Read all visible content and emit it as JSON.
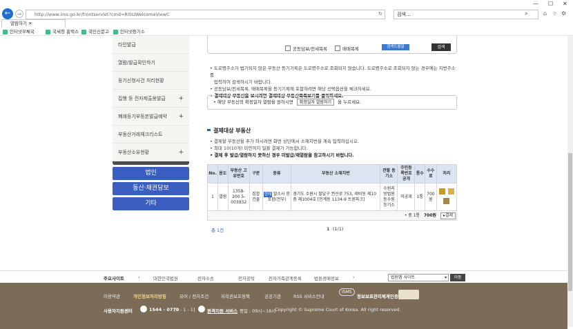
{
  "browser": {
    "url": "http://www.iros.go.kr/frontservlet?cmd=RISUWelcomeViewC",
    "search_placeholder": "검색...",
    "tab_title": "열람하기",
    "favorites": [
      "인터넷우체국",
      "국세청 홈택스",
      "국민신문고",
      "인터넷등기소"
    ]
  },
  "sidebar": {
    "items": [
      {
        "label": "타인발급",
        "plus": ""
      },
      {
        "label": "열람/발급확인하기",
        "plus": ""
      },
      {
        "label": "등기신청사건 처리현황",
        "plus": ""
      },
      {
        "label": "집행 등 전자제출용발급",
        "plus": "+"
      },
      {
        "label": "폐쇄등기부등본발급예약",
        "plus": "+"
      },
      {
        "label": "부동산거래체크리스트",
        "plus": ""
      },
      {
        "label": "부동산소유현황",
        "plus": "+"
      }
    ],
    "buttons": [
      "법인",
      "동산·채권담보",
      "기타"
    ]
  },
  "options": {
    "check1": "공동담보/전세목록",
    "check2": "매매목록",
    "help": "검색도움말",
    "search": "검색"
  },
  "notes": {
    "line1": "도로명주소가 법기되지 않은 부동산 등기기록은 도로명주소로 조회되지 않습니다. 도로명주소로 조회되지 않는 경우에는 지번주소를",
    "line1b": "입력하여 검색하시기 바랍니다.",
    "line2": "공동담보/전세목록, 매매목록을 등기기록에 포함하려면 해당 선택옵션을 체크하세요.",
    "line3": "결제대상 부동산을 보시려면 결제대상 부동산목록보기를 클릭하세요.",
    "box_text": "해당 부동산의 확정일자 열람을 원하시면",
    "box_button": "확정일자 열람하기",
    "box_suffix": "을 누르세요."
  },
  "section": {
    "title": "결제대상 부동산",
    "n1": "결제할 부동산을 추가 하시려면 화면 상단에서 소재지번을 계속 입력하십시오.",
    "n2": "최대 10(10개) 미만까지 일괄 결제가 가능합니다.",
    "n3": "결제 후 발급/열람하지 못하신 경우 미발급/재열람을 참고하시기 바랍니다."
  },
  "table": {
    "headers": [
      "No.",
      "용도",
      "부동산 고유번호",
      "구분",
      "종류",
      "부동산 소재지번",
      "관할 등기소",
      "주민등록번호 공개",
      "통수",
      "수수료",
      "처리"
    ],
    "row": {
      "no": "1",
      "use": "열람",
      "id": "1358-200 5-003932",
      "kind": "집합 건물",
      "type_tag": "현재",
      "type": "말소사 항포함(전부)",
      "addr": "경기도 수원시 팔달구 권선로 753, 제비동 제10층 제1004호 [인계동 1134-9 트윈파크]",
      "office": "수원지방법원 동수원 등기소",
      "rrn": "미공개",
      "count": "1통",
      "fee": "700원"
    },
    "total_label": "• 총 1통",
    "total_fee": "700원",
    "pay_button": "결제"
  },
  "pager": {
    "total": "총 1건",
    "page": "1",
    "of": "(1/1)"
  },
  "footer_links": {
    "label": "주요사이트",
    "items": [
      "대한민국법원",
      "전자소송",
      "전자공탁",
      "전자가족관계등록",
      "법원경매정보"
    ],
    "select": "법원맵 사이트",
    "go": "이동"
  },
  "footer": {
    "links": [
      "이용약관",
      "개인정보처리방침",
      "뷰어 / 전자조건",
      "저작권보호정책",
      "공공기관",
      "RSS 서비스안내"
    ],
    "badge": "ISMS",
    "badge_text": "정보보호관리체계인증",
    "center": "사용자지원센터",
    "phone": "1544 - 0770",
    "ext": "[0 - 1 - 1]",
    "remote": "원격지원 서비스",
    "hours": "평일 : 09시~18시",
    "copyright": "Copyright © Supreme Court of Korea. All right reserved."
  }
}
